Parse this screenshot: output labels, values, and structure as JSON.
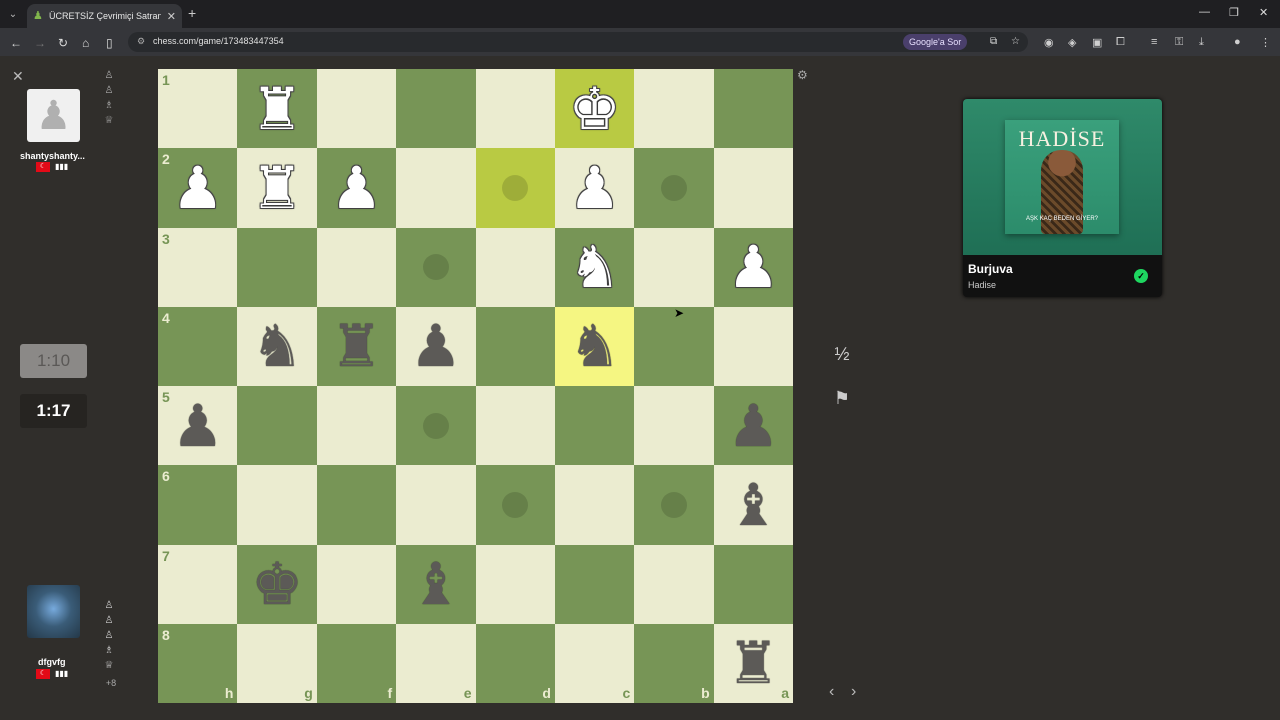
{
  "browser": {
    "tab_title": "ÜCRETSİZ Çevrimiçi Satranç Oy",
    "url": "chess.com/game/173483447354",
    "google_sor": "Google'a Sor"
  },
  "players": {
    "top": {
      "name": "shantyshanty...",
      "flag": "TR",
      "clock": "1:10"
    },
    "bottom": {
      "name": "dfgvfg",
      "flag": "TR",
      "clock": "1:17",
      "material_advantage": "+8"
    }
  },
  "board": {
    "orientation": "black",
    "ranks": [
      "1",
      "2",
      "3",
      "4",
      "5",
      "6",
      "7",
      "8"
    ],
    "files": [
      "h",
      "g",
      "f",
      "e",
      "d",
      "c",
      "b",
      "a"
    ],
    "squares": [
      [
        "",
        "wR",
        "",
        "",
        "",
        "wK",
        "",
        ""
      ],
      [
        "wP",
        "wR",
        "wP",
        "",
        "",
        "wP",
        "",
        ""
      ],
      [
        "",
        "",
        "",
        "",
        "",
        "wN",
        "",
        "wP"
      ],
      [
        "",
        "bN",
        "bR",
        "bP",
        "",
        "bN",
        "",
        ""
      ],
      [
        "bP",
        "",
        "",
        "",
        "",
        "",
        "",
        "bP"
      ],
      [
        "",
        "",
        "",
        "",
        "",
        "",
        "",
        "bB"
      ],
      [
        "",
        "bK",
        "",
        "bB",
        "",
        "",
        "",
        ""
      ],
      [
        "",
        "",
        "",
        "",
        "",
        "",
        "",
        "bR"
      ]
    ],
    "highlights": [
      [
        0,
        5
      ],
      [
        1,
        4
      ],
      [
        3,
        5
      ]
    ],
    "move_hints": [
      [
        1,
        4
      ],
      [
        1,
        6
      ],
      [
        2,
        3
      ],
      [
        4,
        3
      ],
      [
        5,
        4
      ],
      [
        5,
        6
      ],
      [
        2,
        7
      ]
    ]
  },
  "controls": {
    "draw": "½",
    "resign": "resign-flag"
  },
  "music": {
    "cover_title": "HADİSE",
    "cover_subtitle": "AŞK KAÇ BEDEN GİYER?",
    "song": "Burjuva",
    "artist": "Hadise"
  }
}
